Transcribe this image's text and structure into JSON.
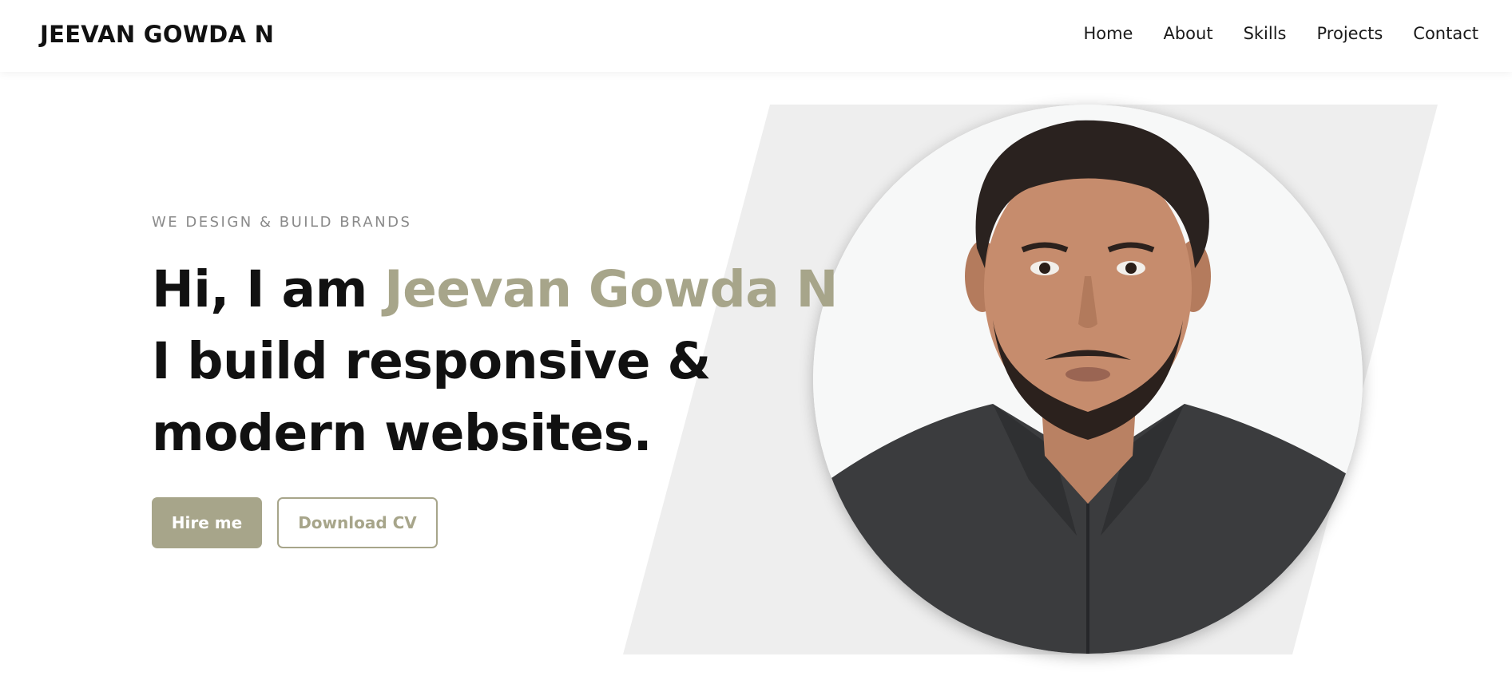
{
  "header": {
    "brand": "JEEVAN GOWDA N",
    "nav": [
      "Home",
      "About",
      "Skills",
      "Projects",
      "Contact"
    ]
  },
  "hero": {
    "eyebrow": "WE DESIGN & BUILD BRANDS",
    "greeting": "Hi, I am ",
    "name": "Jeevan Gowda N",
    "line2": "I build responsive &",
    "line3": "modern websites.",
    "primary_button": "Hire me",
    "secondary_button": "Download CV",
    "photo_alt": "portrait-photo"
  },
  "colors": {
    "accent": "#a7a58a",
    "text": "#111111",
    "muted": "#8a8a8a",
    "panel": "#eeeeee"
  }
}
